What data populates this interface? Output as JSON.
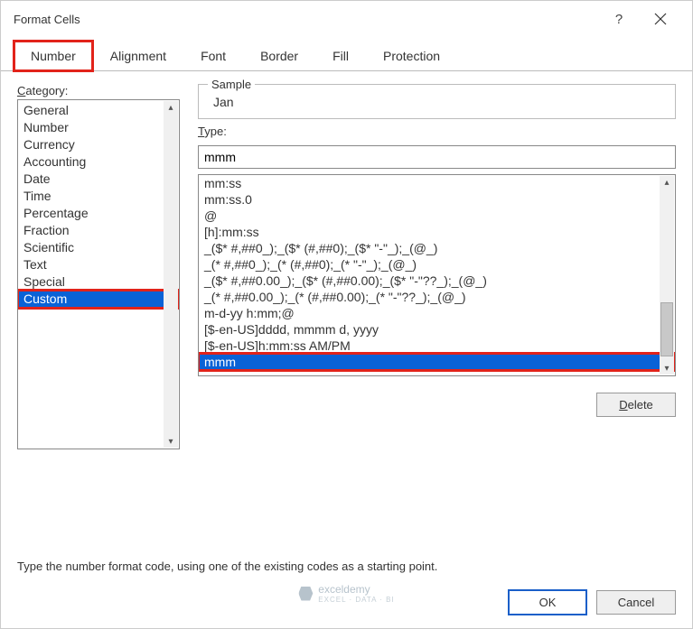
{
  "dialog": {
    "title": "Format Cells",
    "help_tooltip": "Help",
    "close_tooltip": "Close"
  },
  "tabs": [
    {
      "label": "Number",
      "active": true,
      "highlight": true
    },
    {
      "label": "Alignment",
      "active": false,
      "highlight": false
    },
    {
      "label": "Font",
      "active": false,
      "highlight": false
    },
    {
      "label": "Border",
      "active": false,
      "highlight": false
    },
    {
      "label": "Fill",
      "active": false,
      "highlight": false
    },
    {
      "label": "Protection",
      "active": false,
      "highlight": false
    }
  ],
  "category": {
    "label": "Category:",
    "items": [
      "General",
      "Number",
      "Currency",
      "Accounting",
      "Date",
      "Time",
      "Percentage",
      "Fraction",
      "Scientific",
      "Text",
      "Special",
      "Custom"
    ],
    "selected_index": 11,
    "highlight_index": 11
  },
  "sample": {
    "label": "Sample",
    "value": "Jan"
  },
  "type": {
    "label": "Type:",
    "input_value": "mmm",
    "items": [
      "mm:ss",
      "mm:ss.0",
      "@",
      "[h]:mm:ss",
      "_($* #,##0_);_($* (#,##0);_($* \"-\"_);_(@_)",
      "_(* #,##0_);_(* (#,##0);_(* \"-\"_);_(@_)",
      "_($* #,##0.00_);_($* (#,##0.00);_($* \"-\"??_);_(@_)",
      "_(* #,##0.00_);_(* (#,##0.00);_(* \"-\"??_);_(@_)",
      "m-d-yy h:mm;@",
      "[$-en-US]dddd, mmmm d, yyyy",
      "[$-en-US]h:mm:ss AM/PM",
      "mmm"
    ],
    "selected_index": 11,
    "highlight_index": 11
  },
  "buttons": {
    "delete": "Delete",
    "ok": "OK",
    "cancel": "Cancel"
  },
  "note": "Type the number format code, using one of the existing codes as a starting point.",
  "watermark": {
    "name": "exceldemy",
    "sub": "EXCEL · DATA · BI"
  }
}
